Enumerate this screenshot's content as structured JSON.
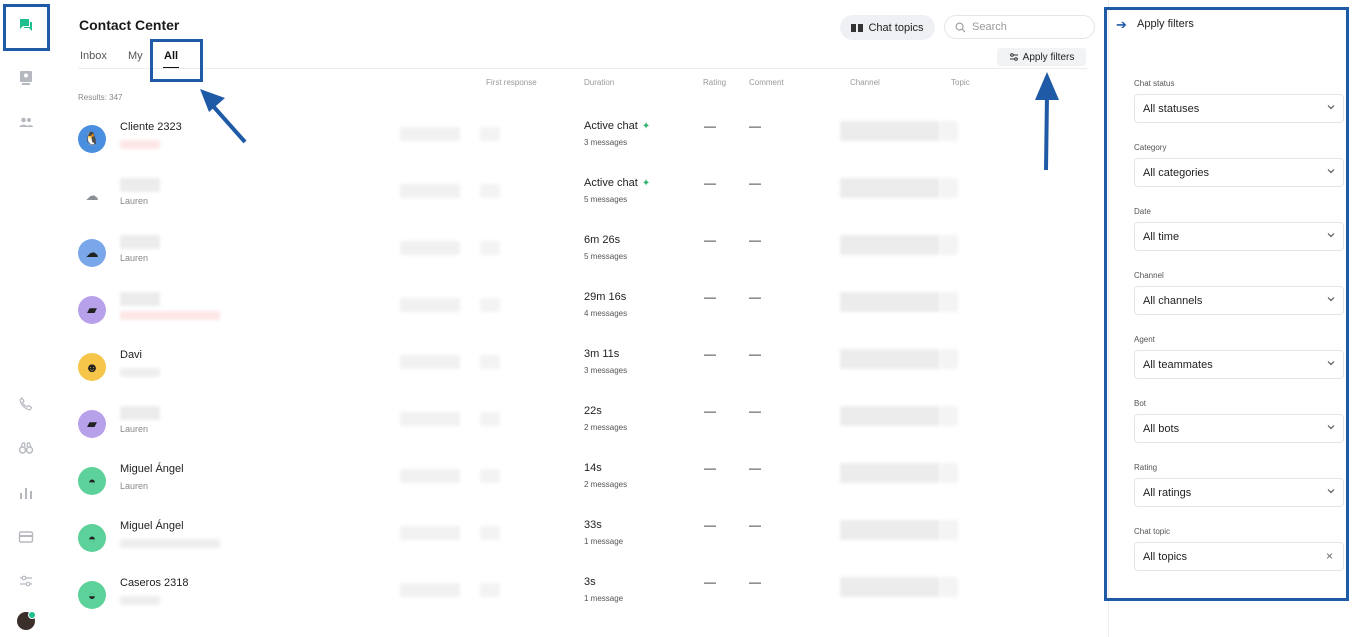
{
  "app": {
    "title": "Contact Center",
    "tabs": [
      "Inbox",
      "My",
      "All"
    ],
    "active_tab": "All",
    "chat_topics_label": "Chat topics",
    "search_placeholder": "Search",
    "apply_filters_label": "Apply filters",
    "results_text": "Results: 347"
  },
  "columns": [
    "First response",
    "Duration",
    "Rating",
    "Comment",
    "Channel",
    "Topic"
  ],
  "rows": [
    {
      "name": "Cliente 2323",
      "sub": "",
      "duration": "Active chat",
      "messages": "3 messages",
      "rating": "—",
      "comment": "—",
      "avatar_bg": "#4a8ee0",
      "avatar_icon": "penguin-icon",
      "active": true
    },
    {
      "name": "",
      "sub": "Lauren",
      "duration": "Active chat",
      "messages": "5 messages",
      "rating": "—",
      "comment": "—",
      "avatar_bg": "#ffffff",
      "avatar_icon": "cloud-icon",
      "active": true
    },
    {
      "name": "",
      "sub": "Lauren",
      "duration": "6m 26s",
      "messages": "5 messages",
      "rating": "—",
      "comment": "—",
      "avatar_bg": "#7aa7ea",
      "avatar_icon": "cloud-icon",
      "active": false
    },
    {
      "name": "",
      "sub": "",
      "duration": "29m 16s",
      "messages": "4 messages",
      "rating": "—",
      "comment": "—",
      "avatar_bg": "#b7a1ea",
      "avatar_icon": "note-icon",
      "active": false
    },
    {
      "name": "Davi",
      "sub": "",
      "duration": "3m 11s",
      "messages": "3 messages",
      "rating": "—",
      "comment": "—",
      "avatar_bg": "#f6c64a",
      "avatar_icon": "robot-icon",
      "active": false
    },
    {
      "name": "",
      "sub": "Lauren",
      "duration": "22s",
      "messages": "2 messages",
      "rating": "—",
      "comment": "—",
      "avatar_bg": "#b7a1ea",
      "avatar_icon": "note-icon",
      "active": false
    },
    {
      "name": "Miguel Ángel",
      "sub": "Lauren",
      "duration": "14s",
      "messages": "2 messages",
      "rating": "—",
      "comment": "—",
      "avatar_bg": "#5cd29a",
      "avatar_icon": "watermelon-icon",
      "active": false
    },
    {
      "name": "Miguel Ángel",
      "sub": "",
      "duration": "33s",
      "messages": "1 message",
      "rating": "—",
      "comment": "—",
      "avatar_bg": "#5cd29a",
      "avatar_icon": "watermelon-icon",
      "active": false
    },
    {
      "name": "Caseros 2318",
      "sub": "",
      "duration": "3s",
      "messages": "1 message",
      "rating": "—",
      "comment": "—",
      "avatar_bg": "#5cd29a",
      "avatar_icon": "cake-icon",
      "active": false
    }
  ],
  "filters": {
    "title": "Apply filters",
    "fields": [
      {
        "label": "Chat status",
        "value": "All statuses",
        "control": "dropdown"
      },
      {
        "label": "Category",
        "value": "All categories",
        "control": "dropdown"
      },
      {
        "label": "Date",
        "value": "All time",
        "control": "dropdown"
      },
      {
        "label": "Channel",
        "value": "All channels",
        "control": "dropdown"
      },
      {
        "label": "Agent",
        "value": "All teammates",
        "control": "dropdown"
      },
      {
        "label": "Bot",
        "value": "All bots",
        "control": "dropdown"
      },
      {
        "label": "Rating",
        "value": "All ratings",
        "control": "dropdown"
      },
      {
        "label": "Chat topic",
        "value": "All topics",
        "control": "clear"
      }
    ]
  },
  "colors": {
    "accent": "#1f5aa6",
    "brand_green": "#1fbf8f"
  }
}
